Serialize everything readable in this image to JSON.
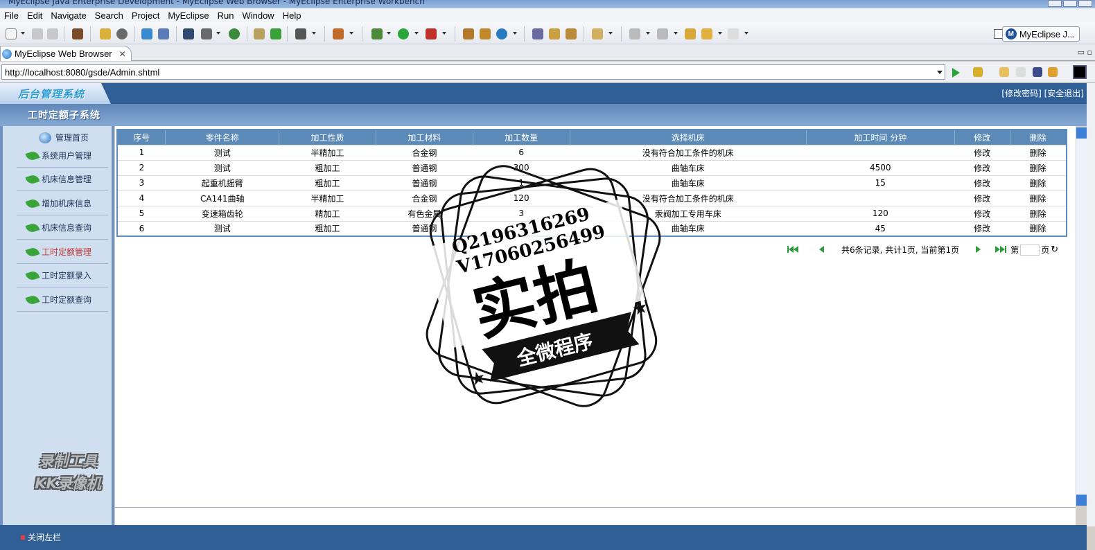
{
  "window": {
    "title": "MyEclipse Java Enterprise Development - MyEclipse Web Browser - MyEclipse Enterprise Workbench"
  },
  "menu": [
    "File",
    "Edit",
    "Navigate",
    "Search",
    "Project",
    "MyEclipse",
    "Run",
    "Window",
    "Help"
  ],
  "perspective": {
    "label": "MyEclipse J..."
  },
  "editor_tab": {
    "label": "MyEclipse Web Browser",
    "close": "✕"
  },
  "browser": {
    "url": "http://localhost:8080/gsde/Admin.shtml"
  },
  "app": {
    "logo": "后台管理系统",
    "links": [
      "[修改密码]",
      "[安全退出]"
    ],
    "subtitle": "工时定额子系统"
  },
  "sidebar": {
    "home": "管理首页",
    "items": [
      "系统用户管理",
      "机床信息管理",
      "增加机床信息",
      "机床信息查询",
      "工时定额管理",
      "工时定额录入",
      "工时定额查询"
    ],
    "active_index": 4
  },
  "watermark": {
    "line1": "录制工具",
    "line2": "KK录像机"
  },
  "stamp": {
    "line1": "Q2196316269",
    "line2": "V17060256499",
    "big": "实拍",
    "banner": "全微程序"
  },
  "table": {
    "headers": [
      "序号",
      "零件名称",
      "加工性质",
      "加工材料",
      "加工数量",
      "选择机床",
      "加工时间 分钟",
      "修改",
      "删除"
    ],
    "rows": [
      [
        "1",
        "测试",
        "半精加工",
        "合金钢",
        "6",
        "没有符合加工条件的机床",
        "",
        "修改",
        "删除"
      ],
      [
        "2",
        "测试",
        "粗加工",
        "普通钢",
        "300",
        "曲轴车床",
        "4500",
        "修改",
        "删除"
      ],
      [
        "3",
        "起重机摇臂",
        "粗加工",
        "普通钢",
        "1",
        "曲轴车床",
        "15",
        "修改",
        "删除"
      ],
      [
        "4",
        "CA141曲轴",
        "半精加工",
        "合金钢",
        "120",
        "没有符合加工条件的机床",
        "",
        "修改",
        "删除"
      ],
      [
        "5",
        "变速箱齿轮",
        "精加工",
        "有色金属",
        "3",
        "汞阀加工专用车床",
        "120",
        "修改",
        "删除"
      ],
      [
        "6",
        "测试",
        "粗加工",
        "普通钢",
        "3",
        "曲轴车床",
        "45",
        "修改",
        "删除"
      ]
    ]
  },
  "pager": {
    "summary": "共6条记录, 共计1页, 当前第1页",
    "page_prefix": "第",
    "page_suffix": "页"
  },
  "footer": {
    "close_left": "关闭左栏"
  },
  "colors": {
    "header_blue": "#2f5f95",
    "grid_header": "#5b8ab8",
    "sidebar_bg": "#cfdff0",
    "active_red": "#c2322c"
  },
  "icons": [
    "globe-icon",
    "leaf-icon",
    "home-globe-icon",
    "go-arrow-icon",
    "first-page-icon",
    "prev-page-icon",
    "next-page-icon",
    "last-page-icon",
    "refresh-icon"
  ]
}
